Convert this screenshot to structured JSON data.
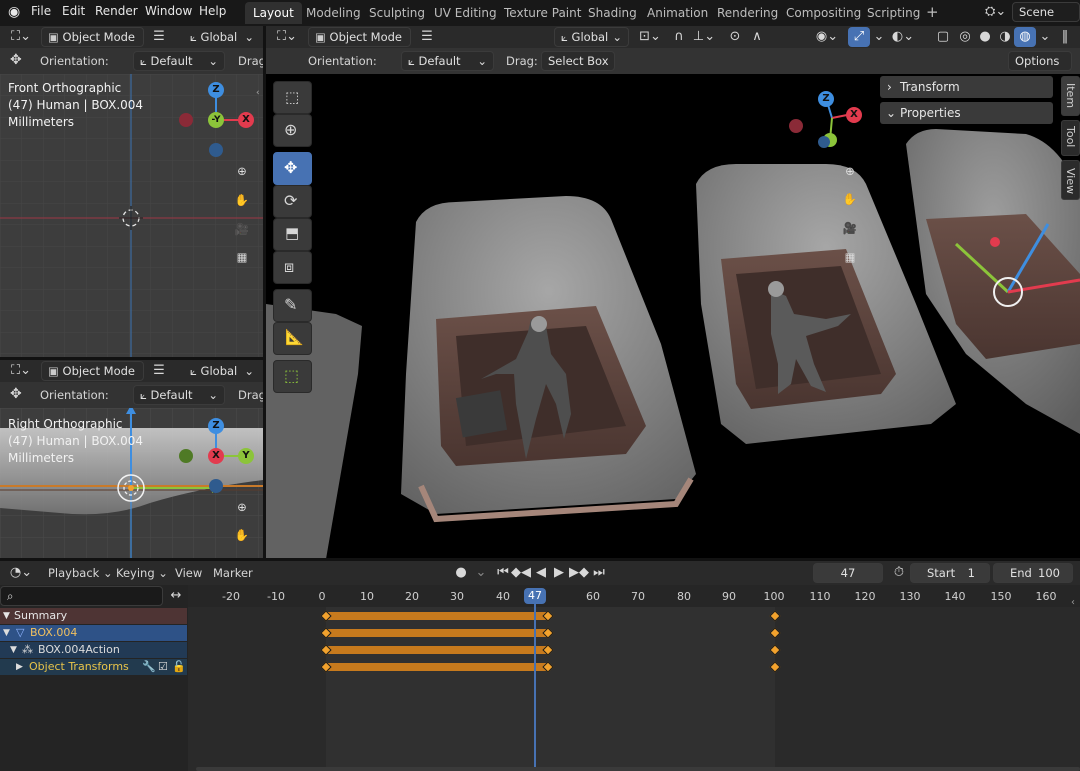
{
  "app": {
    "logo_icon": "blender-logo-icon"
  },
  "menu": [
    "File",
    "Edit",
    "Render",
    "Window",
    "Help"
  ],
  "workspaces": [
    "Layout",
    "Modeling",
    "Sculpting",
    "UV Editing",
    "Texture Paint",
    "Shading",
    "Animation",
    "Rendering",
    "Compositing",
    "Scripting"
  ],
  "workspace_active": "Layout",
  "add_workspace": "+",
  "scene": {
    "name": "Scene"
  },
  "front_view": {
    "mode": "Object Mode",
    "transform": "Global",
    "orientation_label": "Orientation:",
    "orientation": "Default",
    "drag_label": "Drag",
    "title": "Front Orthographic",
    "object": "(47) Human | BOX.004",
    "units": "Millimeters",
    "gizmo": {
      "top": "Z",
      "center": "-Y",
      "right": "X"
    }
  },
  "right_view": {
    "mode": "Object Mode",
    "transform": "Global",
    "orientation_label": "Orientation:",
    "orientation": "Default",
    "drag_label": "Drag",
    "title": "Right Orthographic",
    "object": "(47) Human | BOX.004",
    "units": "Millimeters",
    "gizmo": {
      "top": "Z",
      "center": "X",
      "right": "Y"
    }
  },
  "main_view": {
    "mode": "Object Mode",
    "transform": "Global",
    "orientation_label": "Orientation:",
    "orientation": "Default",
    "drag_label": "Drag:",
    "drag_value": "Select Box",
    "options": "Options",
    "panels": [
      "Transform",
      "Properties"
    ],
    "sidetabs": [
      "Item",
      "Tool",
      "View"
    ],
    "gizmo": {
      "top": "Z",
      "right": "X"
    }
  },
  "timeline": {
    "menus": [
      "Playback",
      "Keying",
      "View",
      "Marker"
    ],
    "current_frame": "47",
    "start_label": "Start",
    "start": "1",
    "end_label": "End",
    "end": "100",
    "ruler": [
      "-20",
      "-10",
      "0",
      "10",
      "20",
      "30",
      "40",
      "47",
      "60",
      "70",
      "80",
      "90",
      "100",
      "110",
      "120",
      "130",
      "140",
      "150",
      "160"
    ],
    "channels": [
      "Summary",
      "BOX.004",
      "BOX.004Action",
      "Object Transforms"
    ]
  },
  "colors": {
    "accent": "#4772b3",
    "keyframe": "#f2a22d",
    "x_axis": "#e23b4e",
    "y_axis": "#8cc43a",
    "z_axis": "#3e8ee0"
  }
}
